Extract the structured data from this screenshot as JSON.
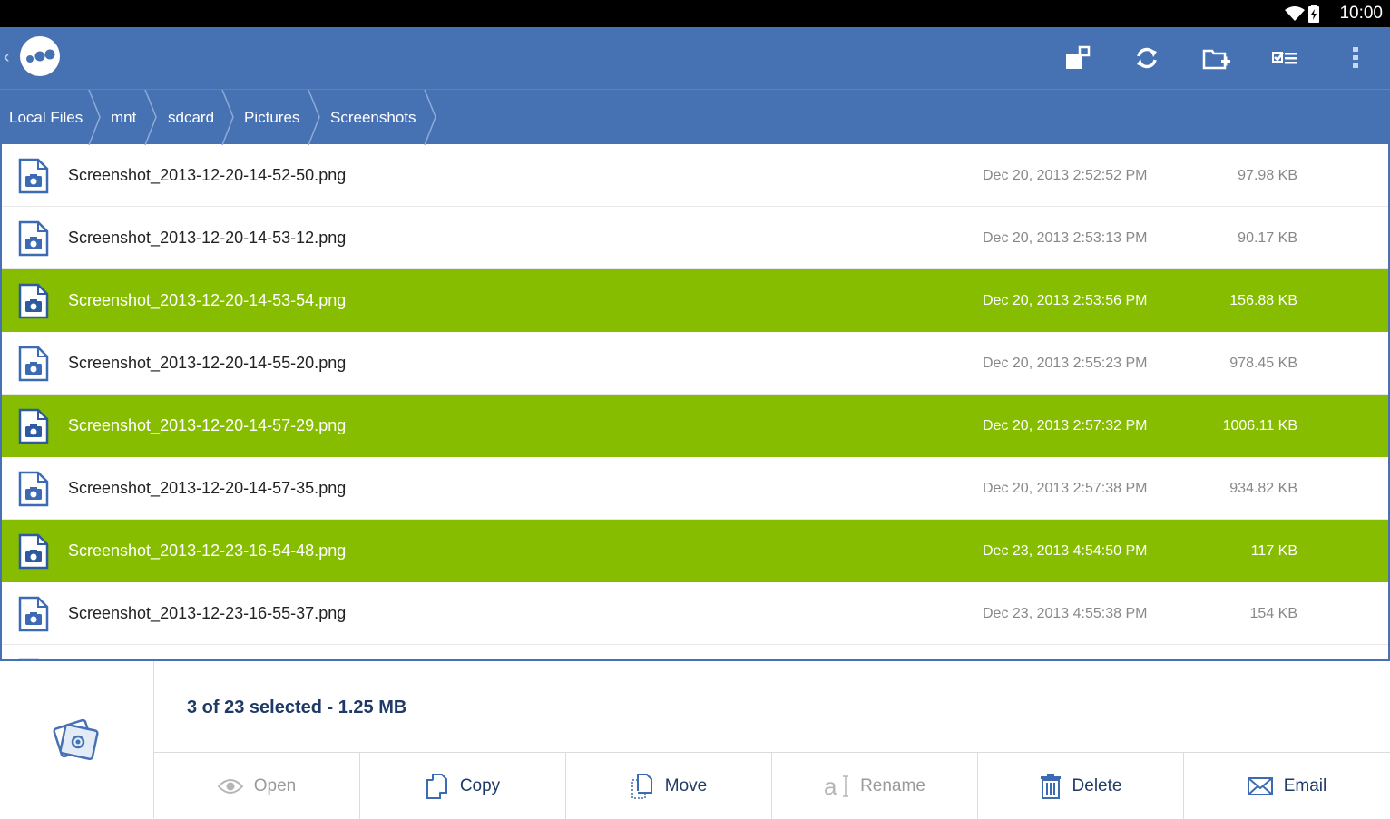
{
  "status_bar": {
    "time": "10:00",
    "icons": [
      "wifi-icon",
      "battery-icon"
    ]
  },
  "app_bar": {
    "logo": "app-logo",
    "actions": [
      "multi-window-icon",
      "refresh-icon",
      "new-folder-icon",
      "select-list-icon",
      "overflow-menu-icon"
    ]
  },
  "breadcrumb": [
    "Local Files",
    "mnt",
    "sdcard",
    "Pictures",
    "Screenshots"
  ],
  "files": [
    {
      "name": "Screenshot_2013-12-20-14-52-50.png",
      "date": "Dec 20, 2013 2:52:52 PM",
      "size": "97.98 KB",
      "selected": false
    },
    {
      "name": "Screenshot_2013-12-20-14-53-12.png",
      "date": "Dec 20, 2013 2:53:13 PM",
      "size": "90.17 KB",
      "selected": false
    },
    {
      "name": "Screenshot_2013-12-20-14-53-54.png",
      "date": "Dec 20, 2013 2:53:56 PM",
      "size": "156.88 KB",
      "selected": true
    },
    {
      "name": "Screenshot_2013-12-20-14-55-20.png",
      "date": "Dec 20, 2013 2:55:23 PM",
      "size": "978.45 KB",
      "selected": false
    },
    {
      "name": "Screenshot_2013-12-20-14-57-29.png",
      "date": "Dec 20, 2013 2:57:32 PM",
      "size": "1006.11 KB",
      "selected": true
    },
    {
      "name": "Screenshot_2013-12-20-14-57-35.png",
      "date": "Dec 20, 2013 2:57:38 PM",
      "size": "934.82 KB",
      "selected": false
    },
    {
      "name": "Screenshot_2013-12-23-16-54-48.png",
      "date": "Dec 23, 2013 4:54:50 PM",
      "size": "117 KB",
      "selected": true
    },
    {
      "name": "Screenshot_2013-12-23-16-55-37.png",
      "date": "Dec 23, 2013 4:55:38 PM",
      "size": "154 KB",
      "selected": false
    }
  ],
  "selection": {
    "summary": "3 of 23 selected - 1.25 MB"
  },
  "actions": [
    {
      "label": "Open",
      "icon": "eye-icon",
      "enabled": false
    },
    {
      "label": "Copy",
      "icon": "copy-icon",
      "enabled": true
    },
    {
      "label": "Move",
      "icon": "move-icon",
      "enabled": true
    },
    {
      "label": "Rename",
      "icon": "rename-icon",
      "enabled": false
    },
    {
      "label": "Delete",
      "icon": "trash-icon",
      "enabled": true
    },
    {
      "label": "Email",
      "icon": "envelope-icon",
      "enabled": true
    }
  ],
  "colors": {
    "primary": "#4672b4",
    "selected": "#86bd00",
    "text_dark": "#1f3a66"
  }
}
